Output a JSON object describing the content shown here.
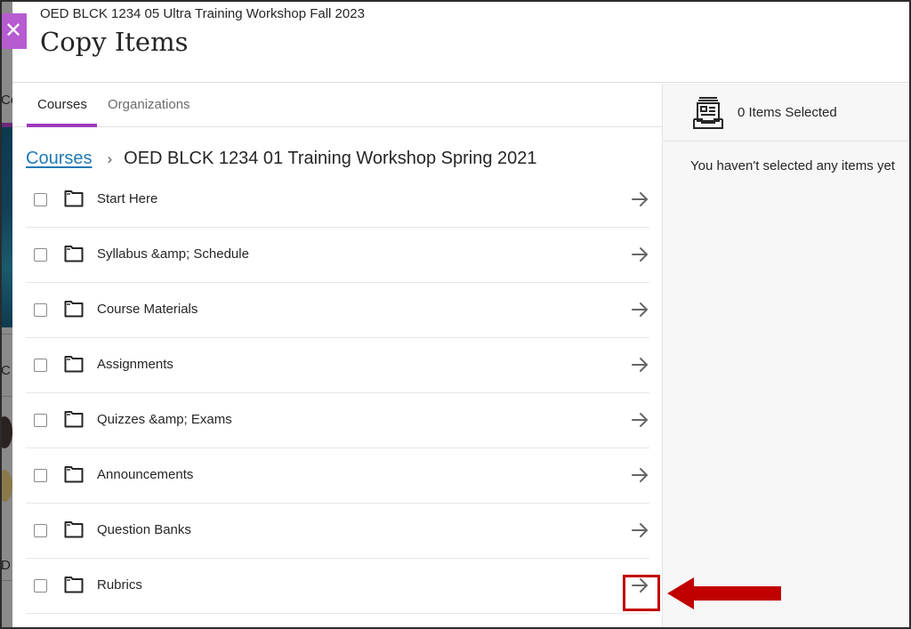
{
  "header": {
    "course_name": "OED BLCK 1234 05 Ultra Training Workshop Fall 2023",
    "title": "Copy Items",
    "close_icon": "close-icon"
  },
  "tabs": [
    {
      "label": "Courses",
      "active": true
    },
    {
      "label": "Organizations",
      "active": false
    }
  ],
  "breadcrumb": {
    "root": "Courses",
    "separator": "›",
    "current": "OED BLCK 1234 01 Training Workshop Spring 2021"
  },
  "items": [
    {
      "label": "Start Here",
      "icon": "folder-icon",
      "checked": false
    },
    {
      "label": "Syllabus &amp; Schedule",
      "icon": "folder-icon",
      "checked": false
    },
    {
      "label": "Course Materials",
      "icon": "folder-icon",
      "checked": false
    },
    {
      "label": "Assignments",
      "icon": "folder-icon",
      "checked": false
    },
    {
      "label": "Quizzes &amp; Exams",
      "icon": "folder-icon",
      "checked": false
    },
    {
      "label": "Announcements",
      "icon": "folder-icon",
      "checked": false
    },
    {
      "label": "Question Banks",
      "icon": "folder-icon",
      "checked": false
    },
    {
      "label": "Rubrics",
      "icon": "folder-icon",
      "checked": false
    }
  ],
  "selection": {
    "count_label": "0 Items Selected",
    "empty_message": "You haven't selected any items yet",
    "icon": "tray-icon"
  },
  "background": {
    "letters": [
      "Co",
      "C",
      "D"
    ]
  },
  "annotation": {
    "target": "Rubrics open arrow",
    "color": "#c00000"
  },
  "colors": {
    "accent": "#9c3bbd",
    "close_button": "#b75bd0",
    "link": "#1f78b4",
    "annotation": "#c00000"
  }
}
